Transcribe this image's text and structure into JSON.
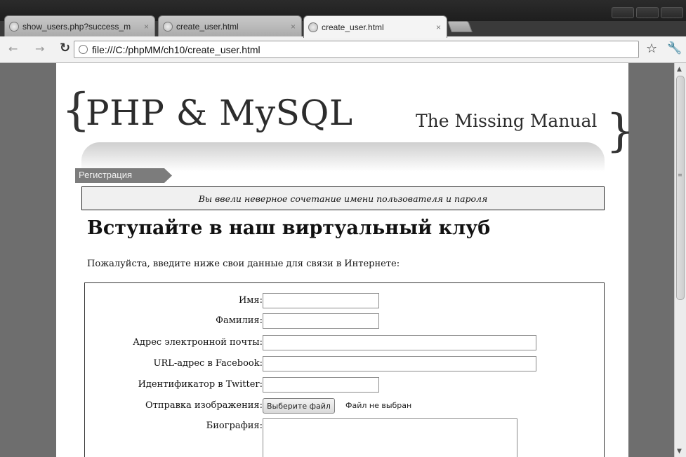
{
  "browser": {
    "tabs": [
      {
        "title": "show_users.php?success_m",
        "active": false
      },
      {
        "title": "create_user.html",
        "active": false
      },
      {
        "title": "create_user.html",
        "active": true
      }
    ],
    "address": "file:///C:/phpMM/ch10/create_user.html"
  },
  "page": {
    "logo_title": "PHP & MySQL",
    "logo_subtitle": "The Missing Manual",
    "brace_left": "{",
    "brace_right": "}",
    "breadcrumb": "Регистрация",
    "error_message": "Вы ввели неверное сочетание имени пользователя и пароля",
    "heading": "Вступайте в наш виртуальный клуб",
    "intro": "Пожалуйста, введите ниже свои данные для связи в Интернете:"
  },
  "form": {
    "first_name_label": "Имя:",
    "last_name_label": "Фамилия:",
    "email_label": "Адрес электронной почты:",
    "facebook_label": "URL-адрес в Facebook:",
    "twitter_label": "Идентификатор в Twitter:",
    "photo_label": "Отправка изображения:",
    "photo_button": "Выберите файл",
    "photo_status": "Файл не выбран",
    "bio_label": "Биография:",
    "first_name_value": "",
    "last_name_value": "",
    "email_value": "",
    "facebook_value": "",
    "twitter_value": ""
  }
}
